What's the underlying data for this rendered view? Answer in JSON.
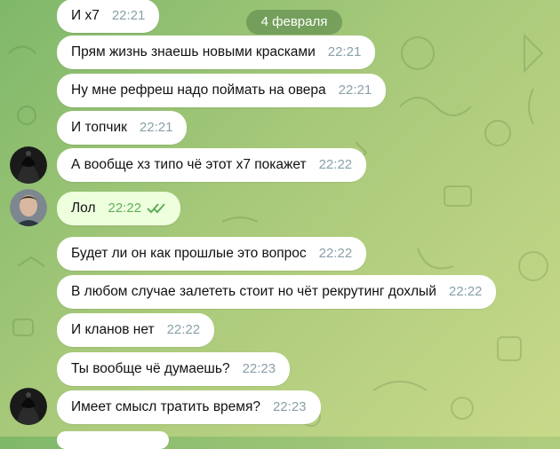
{
  "date_separator": "4 февраля",
  "messages": [
    {
      "text": "И х7",
      "time": "22:21"
    },
    {
      "text": "Прям жизнь знаешь новыми красками",
      "time": "22:21"
    },
    {
      "text": "Ну мне рефреш надо поймать на овера",
      "time": "22:21"
    },
    {
      "text": "И топчик",
      "time": "22:21"
    },
    {
      "text": "А вообще хз типо чё этот х7 покажет",
      "time": "22:22"
    },
    {
      "text": "Лол",
      "time": "22:22",
      "status": "read"
    },
    {
      "text": "Будет ли он как прошлые это вопрос",
      "time": "22:22"
    },
    {
      "text": "В любом случае залететь стоит но чёт рекрутинг дохлый",
      "time": "22:22"
    },
    {
      "text": "И кланов нет",
      "time": "22:22"
    },
    {
      "text": "Ты вообще чё думаешь?",
      "time": "22:23"
    },
    {
      "text": "Имеет смысл тратить время?",
      "time": "22:23"
    }
  ],
  "colors": {
    "incoming_bubble": "#ffffff",
    "outgoing_bubble": "#eeffde",
    "date_pill": "#608c4e",
    "read_ticks": "#5fae5a"
  },
  "icons": {
    "read_status": "double-check-icon",
    "contact_avatar": "hooded-figure-avatar",
    "own_avatar": "user-photo-avatar"
  }
}
